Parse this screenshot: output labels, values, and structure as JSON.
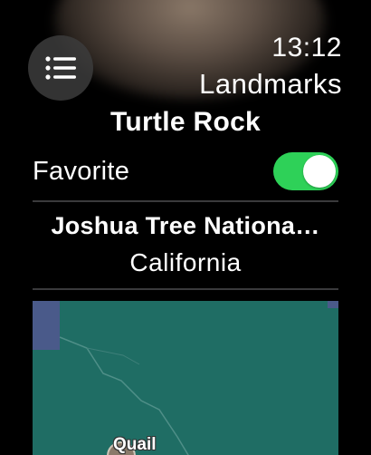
{
  "status": {
    "time": "13:12"
  },
  "nav": {
    "title": "Landmarks",
    "menu_icon": "list-icon"
  },
  "detail": {
    "title": "Turtle Rock",
    "favorite_label": "Favorite",
    "favorite_on": true,
    "park": "Joshua Tree Nationa…",
    "state": "California"
  },
  "map": {
    "place_label": "Quail",
    "colors": {
      "land": "#1f6d64",
      "water": "#4a5a8a",
      "toggle_on": "#2ed158"
    }
  }
}
